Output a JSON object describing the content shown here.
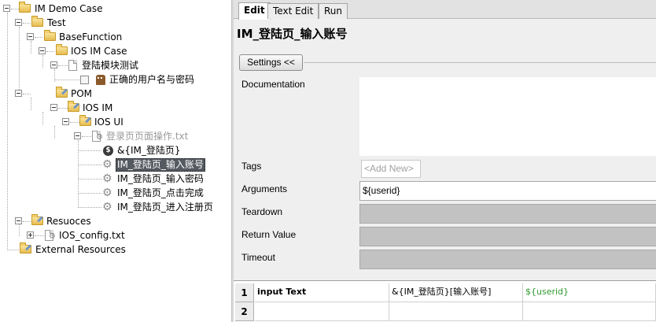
{
  "tree": {
    "nodes": [
      {
        "label": "IM Demo Case"
      },
      {
        "label": "Test"
      },
      {
        "label": "BaseFunction"
      },
      {
        "label": "IOS IM Case"
      },
      {
        "label": "登陆模块测试"
      },
      {
        "label": "正确的用户名与密码"
      },
      {
        "label": "POM"
      },
      {
        "label": "IOS IM"
      },
      {
        "label": "IOS UI"
      },
      {
        "label": "登录页页面操作.txt"
      },
      {
        "label": "&{IM_登陆页}"
      },
      {
        "label": "IM_登陆页_输入账号"
      },
      {
        "label": "IM_登陆页_输入密码"
      },
      {
        "label": "IM_登陆页_点击完成"
      },
      {
        "label": "IM_登陆页_进入注册页"
      },
      {
        "label": "Resuoces"
      },
      {
        "label": "IOS_config.txt"
      },
      {
        "label": "External Resources"
      }
    ]
  },
  "tabs": [
    "Edit",
    "Text Edit",
    "Run"
  ],
  "editor": {
    "title": "IM_登陆页_输入账号",
    "settings_button": "Settings <<",
    "fields": {
      "documentation": "Documentation",
      "tags": "Tags",
      "tags_placeholder": "<Add New>",
      "arguments": "Arguments",
      "arguments_value": "${userid}",
      "teardown": "Teardown",
      "return_value": "Return Value",
      "timeout": "Timeout"
    }
  },
  "grid": {
    "rows": [
      {
        "num": "1",
        "cells": [
          "input Text",
          "&{IM_登陆页}[输入账号]",
          "${userid}"
        ]
      },
      {
        "num": "2",
        "cells": [
          "",
          "",
          ""
        ]
      }
    ]
  },
  "colors": {
    "selection": "#555a60",
    "variable_green": "#2e9a2e",
    "disabled_field": "#c2c2c2"
  }
}
